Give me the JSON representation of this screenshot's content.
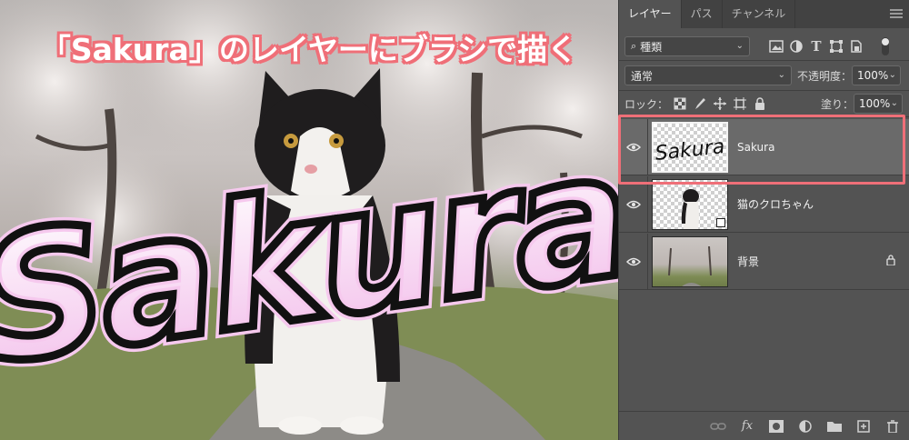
{
  "canvas": {
    "headline": "「Sakura」のレイヤーにブラシで描く",
    "brush_text": "Sakura"
  },
  "panel": {
    "tabs": [
      {
        "label": "レイヤー",
        "active": true
      },
      {
        "label": "パス",
        "active": false
      },
      {
        "label": "チャンネル",
        "active": false
      }
    ],
    "filter": {
      "kind_label": "種類",
      "icons": [
        "image-filter-icon",
        "adjustment-filter-icon",
        "type-filter-icon",
        "shape-filter-icon",
        "smartobject-filter-icon",
        "filter-toggle-icon"
      ]
    },
    "blend_mode": "通常",
    "opacity_label": "不透明度：",
    "opacity_value": "100%",
    "lock_label": "ロック：",
    "fill_label": "塗り：",
    "fill_value": "100%",
    "layers": [
      {
        "name": "Sakura",
        "selected": true,
        "visible": true,
        "thumb_text": "Sakura",
        "locked": false
      },
      {
        "name": "猫のクロちゃん",
        "selected": false,
        "visible": true,
        "locked": false
      },
      {
        "name": "背景",
        "selected": false,
        "visible": true,
        "locked": true
      }
    ],
    "bottom_icons": [
      "link-icon",
      "fx-icon",
      "mask-icon",
      "adjustment-icon",
      "folder-icon",
      "new-layer-icon",
      "trash-icon"
    ],
    "fx_label": "fx"
  },
  "colors": {
    "highlight": "#ef6f78",
    "panel_bg": "#535353",
    "selected_row": "#6a6a6a",
    "brush_stroke": "#111111",
    "brush_glow": "#f6c9ee"
  }
}
